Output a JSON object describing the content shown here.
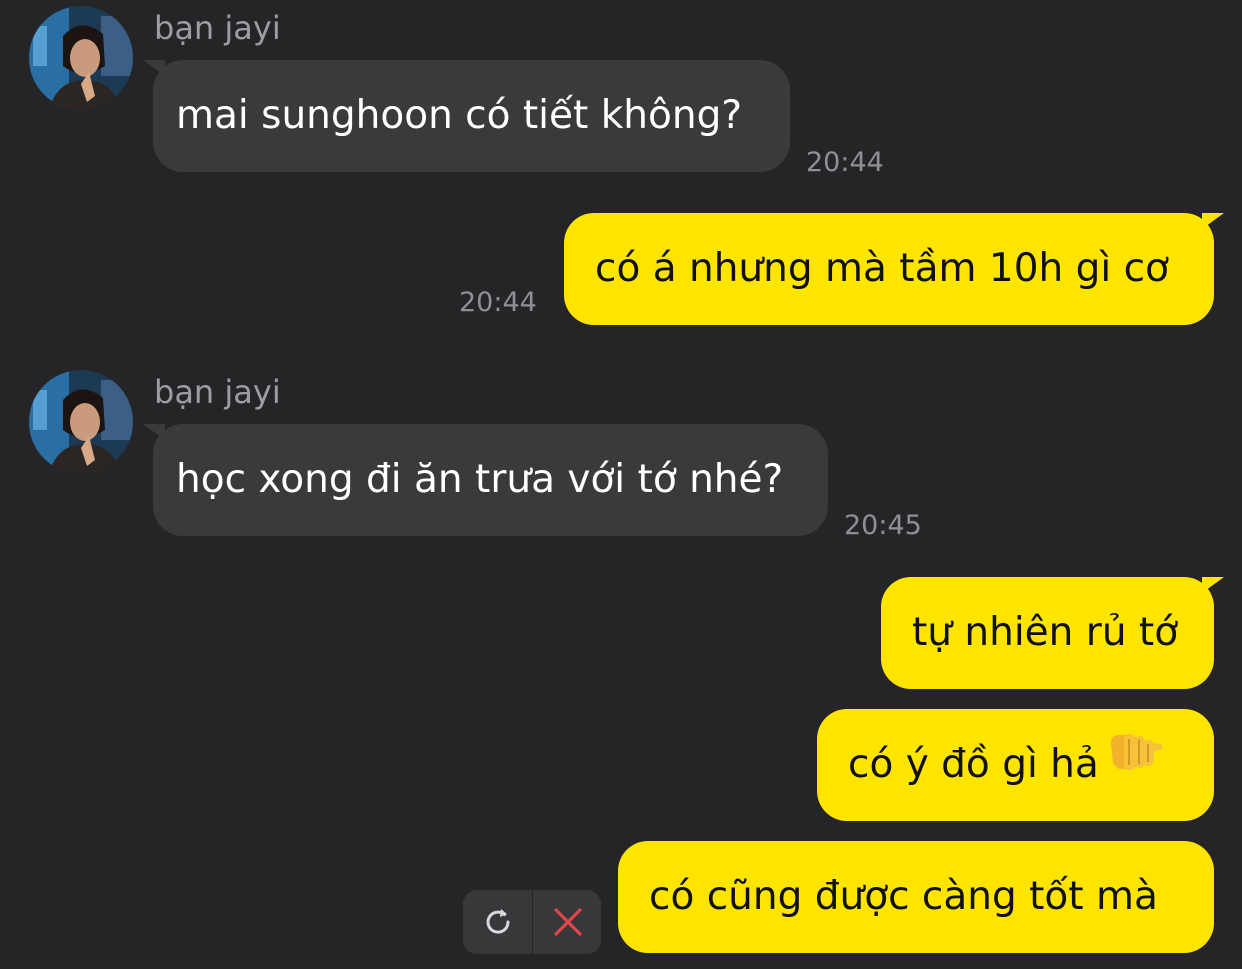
{
  "conversation": {
    "messages": [
      {
        "direction": "incoming",
        "sender": "bạn jayi",
        "text": "mai sunghoon có tiết không?",
        "time": "20:44"
      },
      {
        "direction": "outgoing",
        "text": "có á nhưng mà tầm 10h gì cơ",
        "time": "20:44"
      },
      {
        "direction": "incoming",
        "sender": "bạn jayi",
        "text": "học xong đi ăn trưa với tớ nhé?",
        "time": "20:45"
      },
      {
        "direction": "outgoing",
        "text": "tự nhiên rủ tớ"
      },
      {
        "direction": "outgoing",
        "text": "có ý đồ gì hả",
        "emoji": "backhand-index-pointing-right"
      },
      {
        "direction": "outgoing",
        "text": "có cũng được càng tốt mà",
        "status": "failed"
      }
    ]
  },
  "failed_actions": {
    "retry_icon": "refresh-icon",
    "delete_icon": "close-icon"
  },
  "colors": {
    "background": "#252527",
    "incoming_bubble": "#3a3a3d",
    "outgoing_bubble": "#fee500",
    "delete_red": "#e0474d"
  }
}
